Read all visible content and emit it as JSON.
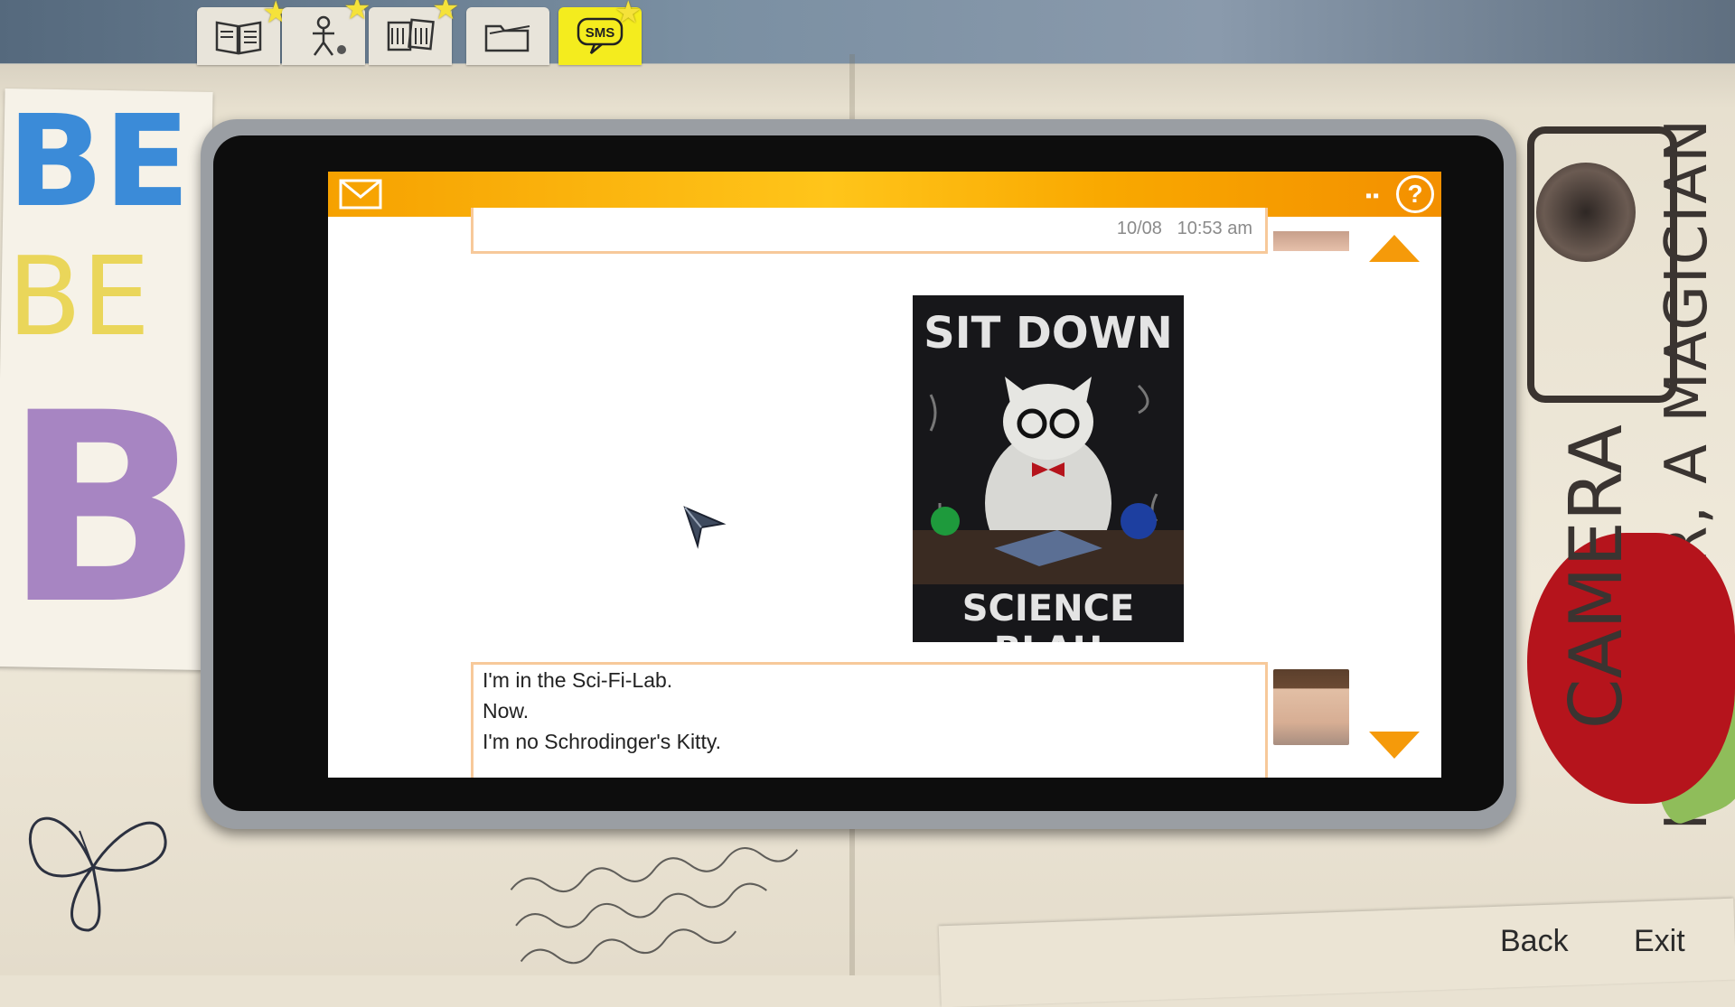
{
  "top_tabs": {
    "items": [
      {
        "name": "journal"
      },
      {
        "name": "characters"
      },
      {
        "name": "photos"
      },
      {
        "name": "files"
      },
      {
        "name": "sms",
        "label": "SMS",
        "active": true
      }
    ]
  },
  "phone": {
    "header": {
      "menu_indicator": "▪▪"
    },
    "previous_message": {
      "date": "10/08",
      "time": "10:53 am"
    },
    "image_message": {
      "line_top": "SIT DOWN",
      "line_bottom": "SCIENCE BLAH"
    },
    "current_message": {
      "lines": [
        "I'm in the Sci-Fi-Lab.",
        "Now.",
        "I'm no Schrodinger's Kitty."
      ]
    }
  },
  "decor": {
    "stickers": [
      "BE",
      "BE",
      "BI"
    ],
    "side_text_1": "I'M A LIAR, A MAGICIAN",
    "side_text_2": "CAMERA"
  },
  "nav": {
    "back": "Back",
    "exit": "Exit"
  },
  "colors": {
    "accent": "#f59a0a",
    "sms_tab": "#f4ec1e",
    "bubble_border": "#f7c99a"
  }
}
